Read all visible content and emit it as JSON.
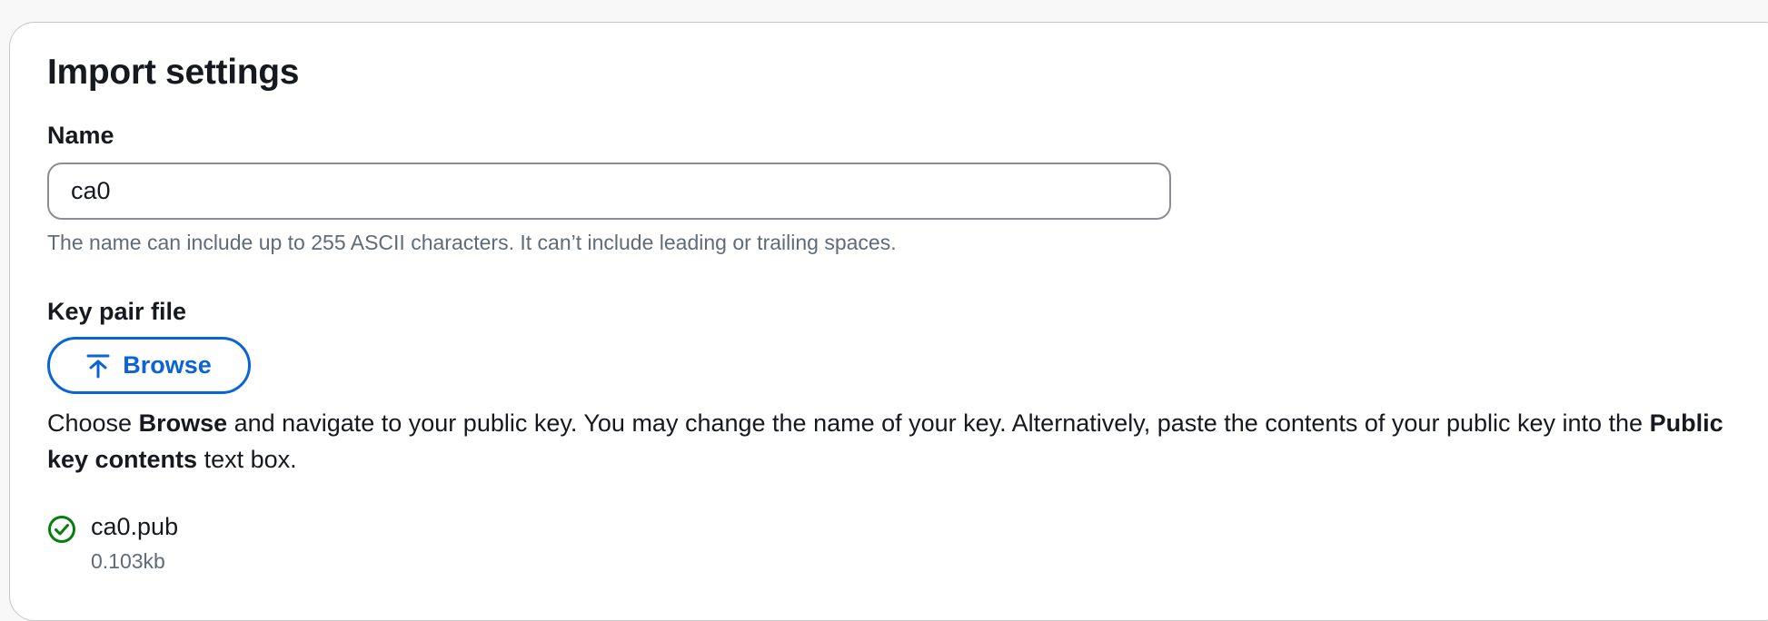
{
  "section": {
    "title": "Import settings"
  },
  "name_field": {
    "label": "Name",
    "value": "ca0",
    "hint": "The name can include up to 255 ASCII characters. It can’t include leading or trailing spaces."
  },
  "key_pair_file": {
    "label": "Key pair file",
    "browse_label": "Browse",
    "browse_icon": "upload-icon",
    "description": {
      "part1": "Choose ",
      "bold1": "Browse",
      "part2": " and navigate to your public key. You may change the name of your key. Alternatively, paste the contents of your public key into the ",
      "bold2": "Public key contents",
      "part3": " text box."
    },
    "file": {
      "icon": "check-circle-icon",
      "name": "ca0.pub",
      "size": "0.103kb"
    }
  },
  "colors": {
    "accent": "#0a64d6",
    "success": "#037f0c",
    "muted_text": "#5f6b7a",
    "border": "#8c8c94"
  }
}
